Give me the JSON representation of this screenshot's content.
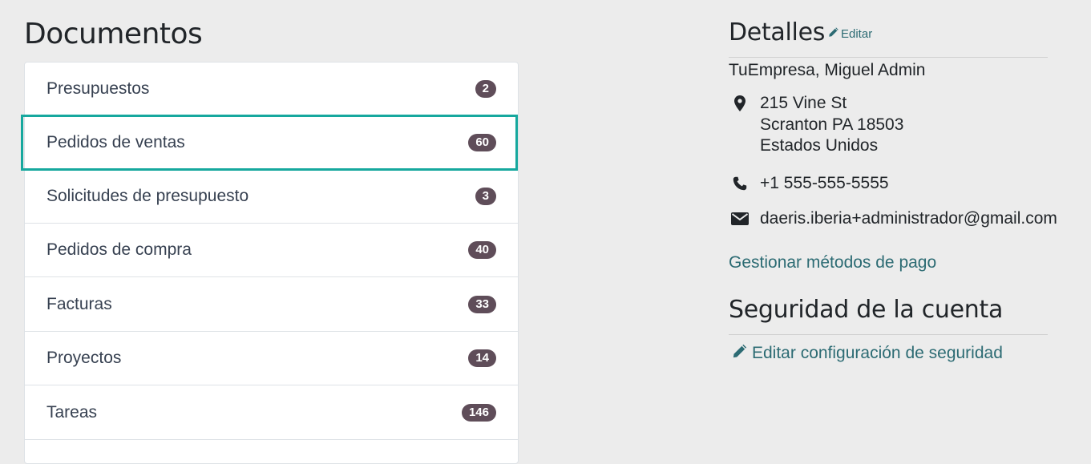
{
  "documents": {
    "title": "Documentos",
    "items": [
      {
        "label": "Presupuestos",
        "count": "2"
      },
      {
        "label": "Pedidos de ventas",
        "count": "60"
      },
      {
        "label": "Solicitudes de presupuesto",
        "count": "3"
      },
      {
        "label": "Pedidos de compra",
        "count": "40"
      },
      {
        "label": "Facturas",
        "count": "33"
      },
      {
        "label": "Proyectos",
        "count": "14"
      },
      {
        "label": "Tareas",
        "count": "146"
      }
    ]
  },
  "details": {
    "title": "Detalles",
    "edit_label": "Editar",
    "company": "TuEmpresa, Miguel Admin",
    "address": {
      "line1": "215 Vine St",
      "line2": "Scranton PA 18503",
      "line3": "Estados Unidos"
    },
    "phone": "+1 555-555-5555",
    "email": "daeris.iberia+administrador@gmail.com",
    "payment_link": "Gestionar métodos de pago"
  },
  "security": {
    "title": "Seguridad de la cuenta",
    "edit_link": "Editar configuración de seguridad"
  },
  "colors": {
    "highlight": "#16a89e",
    "badge": "#5f4d59",
    "link": "#2c6b73"
  },
  "icons": {
    "address": "map-marker-icon",
    "phone": "phone-icon",
    "email": "envelope-icon",
    "edit": "pencil-icon"
  }
}
